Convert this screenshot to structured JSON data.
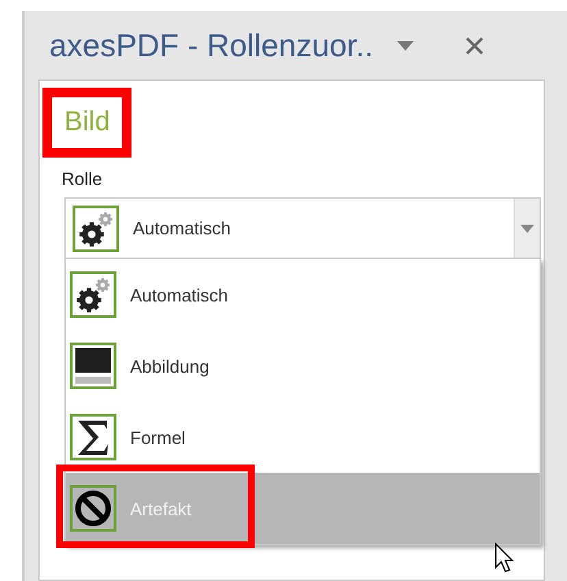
{
  "pane": {
    "title": "axesPDF - Rollenzuor.."
  },
  "heading": {
    "text": "Bild",
    "highlighted": true
  },
  "role_field": {
    "label": "Rolle",
    "value": "Automatisch",
    "kind": "gear",
    "expanded": true
  },
  "options": [
    {
      "label": "Automatisch",
      "kind": "gear",
      "selected": false,
      "highlighted": false
    },
    {
      "label": "Abbildung",
      "kind": "picture",
      "selected": false,
      "highlighted": false
    },
    {
      "label": "Formel",
      "kind": "sigma",
      "selected": false,
      "highlighted": false
    },
    {
      "label": "Artefakt",
      "kind": "blocked",
      "selected": true,
      "highlighted": true
    }
  ]
}
